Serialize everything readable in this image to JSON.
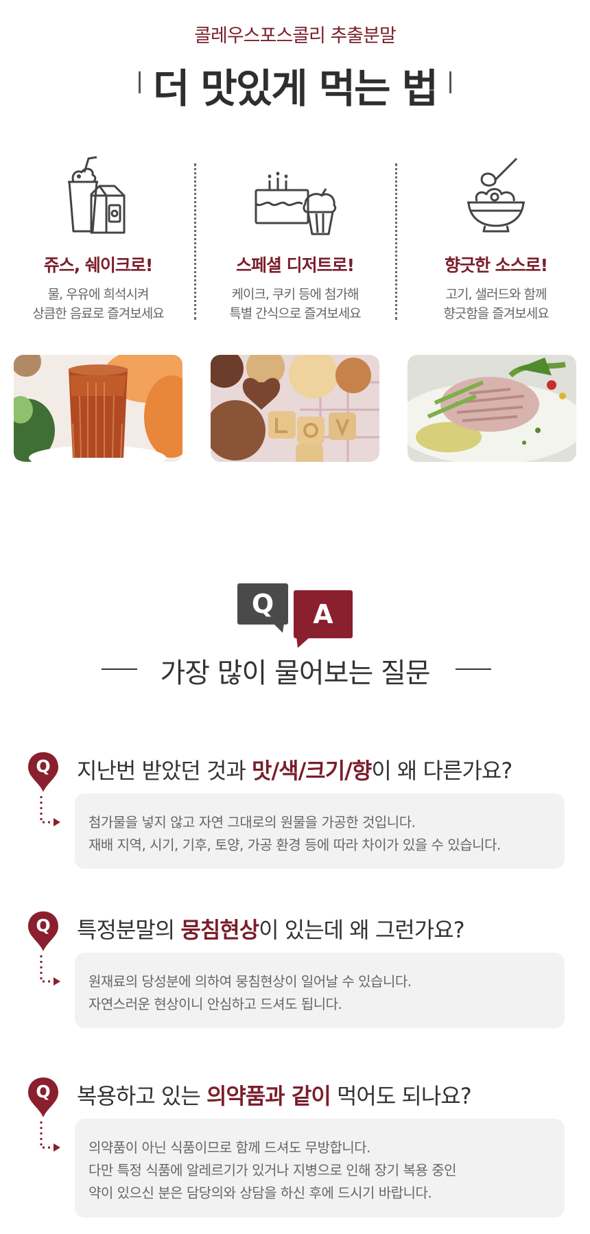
{
  "header": {
    "subtitle": "콜레우스포스콜리 추출분말",
    "title": "더 맛있게 먹는 법"
  },
  "usage": [
    {
      "icon": "juice-milk-icon",
      "title": "쥬스, 쉐이크로!",
      "line1": "물, 우유에 희석시켜",
      "line2": "상큼한 음료로 즐겨보세요"
    },
    {
      "icon": "cake-cupcake-icon",
      "title": "스페셜 디저트로!",
      "line1": "케이크, 쿠키 등에  첨가해",
      "line2": "특별 간식으로 즐겨보세요"
    },
    {
      "icon": "salad-bowl-icon",
      "title": "향긋한 소스로!",
      "line1": "고기, 샐러드와 함께",
      "line2": "향긋함을 즐겨보세요"
    }
  ],
  "qa_badge": {
    "q": "Q",
    "a": "A"
  },
  "faq_title": "가장 많이 물어보는 질문",
  "faq": [
    {
      "badge": "Q",
      "q_before": "지난번 받았던 것과 ",
      "q_highlight": "맛/색/크기/향",
      "q_after": "이 왜 다른가요?",
      "answer": [
        "첨가물을 넣지 않고 자연 그대로의 원물을 가공한 것입니다.",
        "재배 지역, 시기, 기후, 토양, 가공 환경 등에 따라 차이가 있을 수 있습니다."
      ]
    },
    {
      "badge": "Q",
      "q_before": "특정분말의 ",
      "q_highlight": "뭉침현상",
      "q_after": "이 있는데 왜 그런가요?",
      "answer": [
        "원재료의 당성분에 의하여 뭉침현상이 일어날 수 있습니다.",
        "자연스러운 현상이니 안심하고 드셔도 됩니다."
      ]
    },
    {
      "badge": "Q",
      "q_before": "복용하고 있는 ",
      "q_highlight": "의약품과 같이",
      "q_after": " 먹어도 되나요?",
      "answer": [
        "의약품이 아닌 식품이므로 함께 드셔도 무방합니다.",
        "다만 특정 식품에 알레르기가 있거나 지병으로 인해 장기 복용 중인",
        "약이 있으신 분은 담당의와 상담을 하신 후에 드시기 바랍니다."
      ]
    }
  ],
  "colors": {
    "accent": "#7a1e2b",
    "a_badge": "#8a1f2e",
    "q_badge": "#4a4a4a",
    "answer_bg": "#f2f2f2"
  }
}
